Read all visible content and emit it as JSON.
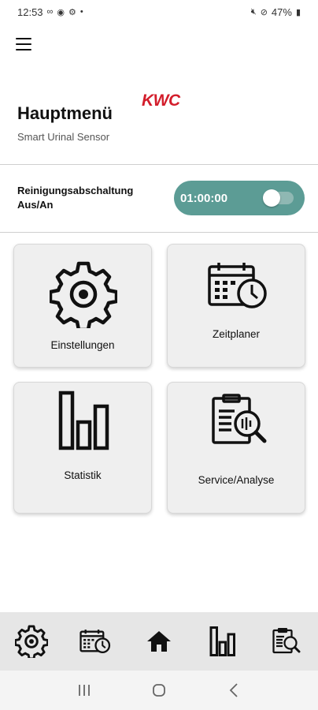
{
  "status_bar": {
    "time": "12:53",
    "battery": "47%"
  },
  "header": {
    "title": "Hauptmenü",
    "subtitle": "Smart Urinal Sensor",
    "logo_text": "KWC"
  },
  "cleaning": {
    "label_line1": "Reinigungsabschaltung",
    "label_line2": "Aus/An",
    "time": "01:00:00",
    "switch_on": false,
    "accent_color": "#5c9c95"
  },
  "tiles": [
    {
      "label": "Einstellungen",
      "icon": "gear-icon"
    },
    {
      "label": "Zeitplaner",
      "icon": "calendar-clock-icon"
    },
    {
      "label": "Statistik",
      "icon": "bar-chart-icon"
    },
    {
      "label": "Service/Analyse",
      "icon": "report-search-icon"
    }
  ],
  "bottom_nav": [
    {
      "icon": "gear-icon"
    },
    {
      "icon": "calendar-clock-icon"
    },
    {
      "icon": "home-icon"
    },
    {
      "icon": "bar-chart-icon"
    },
    {
      "icon": "report-search-icon"
    }
  ]
}
